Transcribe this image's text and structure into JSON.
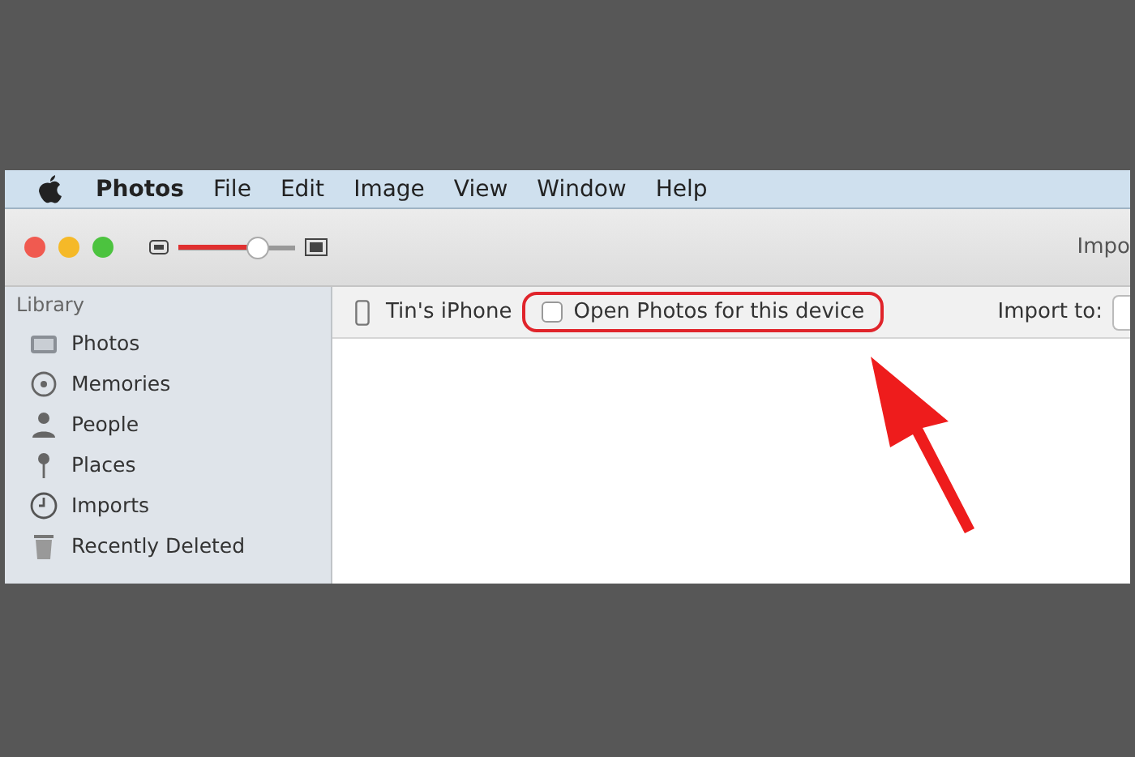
{
  "menu_bar": {
    "app_name": "Photos",
    "items": [
      "File",
      "Edit",
      "Image",
      "View",
      "Window",
      "Help"
    ]
  },
  "toolbar": {
    "zoom_slider": {
      "level": 0.68
    },
    "right_text": "Impo"
  },
  "sidebar": {
    "heading": "Library",
    "items": [
      {
        "label": "Photos",
        "kind": "photos",
        "selected": false
      },
      {
        "label": "Memories",
        "kind": "memories",
        "selected": false
      },
      {
        "label": "People",
        "kind": "people",
        "selected": false
      },
      {
        "label": "Places",
        "kind": "places",
        "selected": false
      },
      {
        "label": "Imports",
        "kind": "imports",
        "selected": false
      },
      {
        "label": "Recently Deleted",
        "kind": "trash",
        "selected": false
      }
    ]
  },
  "device_bar": {
    "device_name": "Tin's iPhone",
    "open_photos_checkbox": {
      "label": "Open Photos for this device",
      "checked": false,
      "highlighted": true
    },
    "import_to_label": "Import to:"
  },
  "annotation": {
    "arrow": true
  }
}
